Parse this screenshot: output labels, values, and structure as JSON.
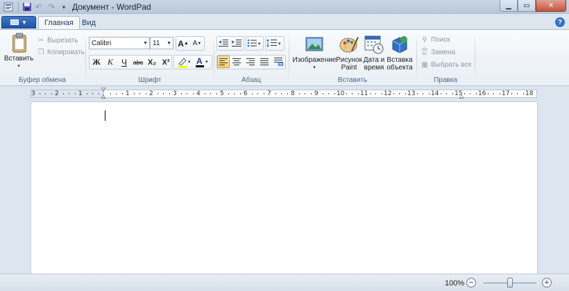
{
  "window": {
    "title": "Документ - WordPad"
  },
  "tabs": {
    "home": "Главная",
    "view": "Вид"
  },
  "clipboard": {
    "paste": "Вставить",
    "cut": "Вырезать",
    "copy": "Копировать",
    "label": "Буфер обмена"
  },
  "font": {
    "family": "Calibri",
    "size": "11",
    "bold": "Ж",
    "italic": "К",
    "underline": "Ч",
    "strike": "abc",
    "subscript": "X₂",
    "superscript": "X²",
    "grow": "A",
    "shrink": "A",
    "color_letter": "A",
    "label": "Шрифт"
  },
  "paragraph": {
    "label": "Абзац",
    "active_alignment": "left"
  },
  "insert": {
    "picture": "Изображение",
    "paint_1": "Рисунок",
    "paint_2": "Paint",
    "datetime_1": "Дата и",
    "datetime_2": "время",
    "object_1": "Вставка",
    "object_2": "объекта",
    "label": "Вставить"
  },
  "editing": {
    "find": "Поиск",
    "replace": "Замена",
    "select_all": "Выбрать все",
    "label": "Правка"
  },
  "ruler": {
    "ticks": [
      "3",
      "2",
      "1",
      "1",
      "2",
      "3",
      "4",
      "5",
      "6",
      "7",
      "8",
      "9",
      "10",
      "11",
      "12",
      "13",
      "14",
      "15",
      "16",
      "17",
      "18"
    ]
  },
  "status": {
    "zoom": "100%",
    "zoom_out": "−",
    "zoom_in": "+"
  },
  "colors": {
    "file_button": "#1f55a7",
    "font_color_bar": "#000000",
    "highlight_bar": "#ffff00",
    "active_align": "#ffd263"
  }
}
